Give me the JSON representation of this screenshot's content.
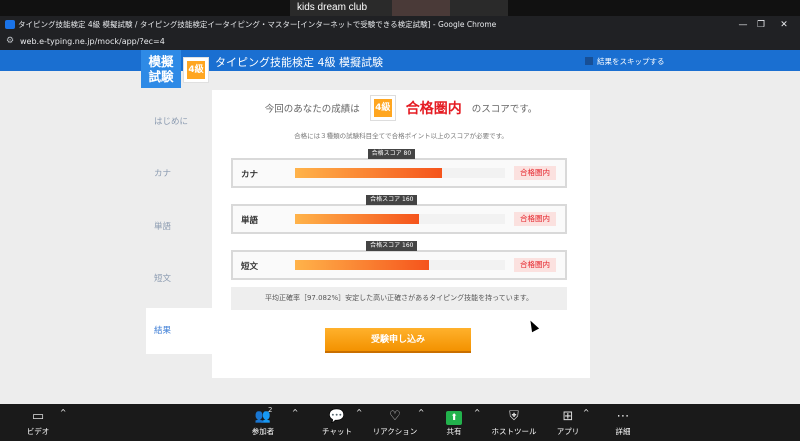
{
  "zoom_top": {
    "participant_name": "kids dream club"
  },
  "browser": {
    "tab_title": "タイピング技能検定 4級 模擬試験 / タイピング技能検定イータイピング・マスター[インターネットで受験できる検定試験] - Google Chrome",
    "url": "web.e-typing.ne.jp/mock/app/?ec=4",
    "win_minimize": "—",
    "win_restore": "❐",
    "win_close": "✕",
    "tune_icon": "⚙"
  },
  "header": {
    "logo_line1": "模擬",
    "logo_line2": "試験",
    "level_badge": "4級",
    "title": "タイピング技能検定 4級 模擬試験",
    "skip_label": "結果をスキップする"
  },
  "sidebar": {
    "items": [
      {
        "label": "はじめに"
      },
      {
        "label": "カナ"
      },
      {
        "label": "単語"
      },
      {
        "label": "短文"
      },
      {
        "label": "結果",
        "active": true
      }
    ]
  },
  "result": {
    "lead": "今回のあなたの成績は",
    "level_badge": "4級",
    "result_text": "合格圏内",
    "tail": "のスコアです。",
    "note": "合格には３種類の試験科目全てで合格ポイント以上のスコアが必要です。",
    "rows": [
      {
        "label": "カナ",
        "pass_label": "合格スコア 80",
        "fill_fraction": 0.7,
        "pass_fraction": 0.46,
        "status": "合格圏内"
      },
      {
        "label": "単語",
        "pass_label": "合格スコア 160",
        "fill_fraction": 0.59,
        "pass_fraction": 0.46,
        "status": "合格圏内"
      },
      {
        "label": "短文",
        "pass_label": "合格スコア 160",
        "fill_fraction": 0.64,
        "pass_fraction": 0.46,
        "status": "合格圏内"
      }
    ],
    "comment": "平均正確率［97.082%］安定した高い正確さがあるタイピング技能を持っています。",
    "apply_button": "受験申し込み"
  },
  "zoom_toolbar": {
    "items": [
      {
        "label": "ビデオ",
        "icon": "video-icon",
        "glyph": "▭"
      },
      {
        "label": "参加者",
        "icon": "participants-icon",
        "glyph": "👥",
        "count": "2"
      },
      {
        "label": "チャット",
        "icon": "chat-icon",
        "glyph": "💬"
      },
      {
        "label": "リアクション",
        "icon": "reaction-icon",
        "glyph": "♡"
      },
      {
        "label": "共有",
        "icon": "share-icon",
        "glyph": "⬆"
      },
      {
        "label": "ホストツール",
        "icon": "shield-icon",
        "glyph": "⛨"
      },
      {
        "label": "アプリ",
        "icon": "apps-icon",
        "glyph": "⊞"
      },
      {
        "label": "詳細",
        "icon": "more-icon",
        "glyph": "⋯"
      }
    ],
    "caret": "^"
  }
}
